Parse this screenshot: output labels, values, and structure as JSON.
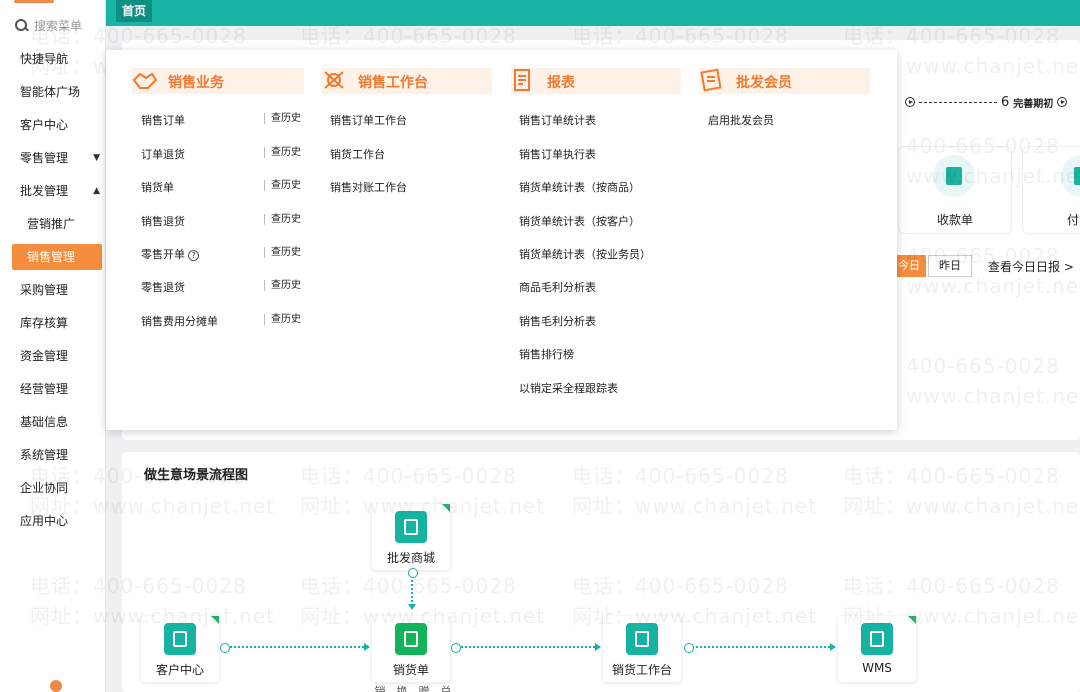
{
  "sidebar": {
    "search_placeholder": "搜索菜单",
    "items": [
      {
        "label": "快捷导航"
      },
      {
        "label": "智能体广场"
      },
      {
        "label": "客户中心"
      },
      {
        "label": "零售管理",
        "caret": "▼"
      },
      {
        "label": "批发管理",
        "caret": "▲"
      },
      {
        "label": "营销推广"
      },
      {
        "label": "销售管理"
      },
      {
        "label": "采购管理"
      },
      {
        "label": "库存核算"
      },
      {
        "label": "资金管理"
      },
      {
        "label": "经营管理"
      },
      {
        "label": "基础信息"
      },
      {
        "label": "系统管理"
      },
      {
        "label": "企业协同"
      },
      {
        "label": "应用中心"
      }
    ]
  },
  "topbar": {
    "home_tab": "首页"
  },
  "mega_menu": {
    "col1": {
      "title": "销售业务",
      "items": [
        "销售订单",
        "订单退货",
        "销货单",
        "销售退货",
        "零售开单",
        "零售退货",
        "销售费用分摊单"
      ],
      "history_label": "查历史",
      "help_mark": "?"
    },
    "col2": {
      "title": "销售工作台",
      "items": [
        "销售订单工作台",
        "销货工作台",
        "销售对账工作台"
      ]
    },
    "col3": {
      "title": "报表",
      "items": [
        "销售订单统计表",
        "销售订单执行表",
        "销货单统计表（按商品）",
        "销货单统计表（按客户）",
        "销货单统计表（按业务员）",
        "商品毛利分析表",
        "销售毛利分析表",
        "销售排行榜",
        "以销定采全程跟踪表"
      ]
    },
    "col4": {
      "title": "批发会员",
      "items": [
        "启用批发会员"
      ]
    }
  },
  "dashboard": {
    "period_step": "6",
    "period_label": "完善期初",
    "tile_receipt": "收款单",
    "tile_pay": "付",
    "btn_today": "今日",
    "btn_yesterday": "昨日",
    "daily_link": "查看今日日报 >"
  },
  "flow": {
    "title": "做生意场景流程图",
    "nodes": {
      "mall": "批发商城",
      "customer": "客户中心",
      "sale": "销货单",
      "workbench": "销货工作台",
      "wms": "WMS"
    },
    "sale_sub": "销、换、赠、兑"
  },
  "watermark": {
    "phone": "电话：400-665-0028",
    "site": "网址：www.chanjet.net"
  },
  "colors": {
    "teal": "#18b5a6",
    "orange": "#f58d3f",
    "green": "#12b35a"
  }
}
